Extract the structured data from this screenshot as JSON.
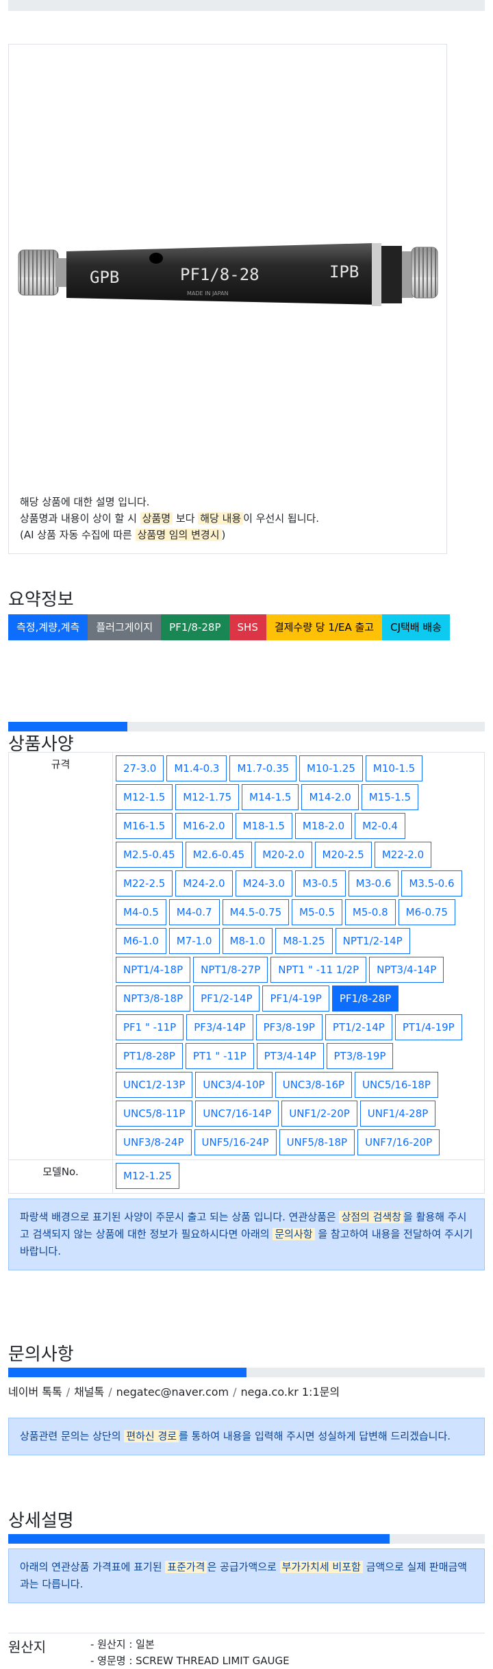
{
  "product": {
    "image_text": {
      "left": "GPB",
      "middle": "PF1/8-28",
      "right": "IPB",
      "small": "MADE IN JAPAN"
    },
    "desc_line1": "해당 상품에 대한 설명 입니다.",
    "desc_line2_a": "상품명과 내용이 상이 할 시 ",
    "desc_line2_hl1": "상품명",
    "desc_line2_b": " 보다 ",
    "desc_line2_hl2": "해당 내용",
    "desc_line2_c": "이 우선시 됩니다.",
    "desc_line3_a": "(AI 상품 자동 수집에 따른 ",
    "desc_line3_hl": "상품명 임의 변경시",
    "desc_line3_b": ")"
  },
  "summary": {
    "title": "요약정보",
    "badges": [
      {
        "label": "측정,계량,계측",
        "bg": "#0d6efd",
        "fg": "#ffffff"
      },
      {
        "label": "플러그게이지",
        "bg": "#6c757d",
        "fg": "#ffffff"
      },
      {
        "label": "PF1/8-28P",
        "bg": "#198754",
        "fg": "#ffffff"
      },
      {
        "label": "SHS",
        "bg": "#dc3545",
        "fg": "#ffffff"
      },
      {
        "label": "결제수량 당 1/EA 출고",
        "bg": "#ffc107",
        "fg": "#000000"
      },
      {
        "label": "CJ택배 배송",
        "bg": "#0dcaf0",
        "fg": "#000000"
      }
    ]
  },
  "spec": {
    "title": "상품사양",
    "progress": 0.25,
    "spec_label": "규격",
    "model_label": "모델No.",
    "rows": [
      [
        "27-3.0",
        "M1.4-0.3",
        "M1.7-0.35",
        "M10-1.25",
        "M10-1.5"
      ],
      [
        "M12-1.5",
        "M12-1.75",
        "M14-1.5",
        "M14-2.0",
        "M15-1.5"
      ],
      [
        "M16-1.5",
        "M16-2.0",
        "M18-1.5",
        "M18-2.0",
        "M2-0.4"
      ],
      [
        "M2.5-0.45",
        "M2.6-0.45",
        "M20-2.0",
        "M20-2.5",
        "M22-2.0"
      ],
      [
        "M22-2.5",
        "M24-2.0",
        "M24-3.0",
        "M3-0.5",
        "M3-0.6",
        "M3.5-0.6"
      ],
      [
        "M4-0.5",
        "M4-0.7",
        "M4.5-0.75",
        "M5-0.5",
        "M5-0.8",
        "M6-0.75"
      ],
      [
        "M6-1.0",
        "M7-1.0",
        "M8-1.0",
        "M8-1.25",
        "NPT1/2-14P"
      ],
      [
        "NPT1/4-18P",
        "NPT1/8-27P",
        "NPT1 \" -11 1/2P",
        "NPT3/4-14P"
      ],
      [
        "NPT3/8-18P",
        "PF1/2-14P",
        "PF1/4-19P",
        "PF1/8-28P"
      ],
      [
        "PF1 \" -11P",
        "PF3/4-14P",
        "PF3/8-19P",
        "PT1/2-14P",
        "PT1/4-19P"
      ],
      [
        "PT1/8-28P",
        "PT1 \" -11P",
        "PT3/4-14P",
        "PT3/8-19P"
      ],
      [
        "UNC1/2-13P",
        "UNC3/4-10P",
        "UNC3/8-16P",
        "UNC5/16-18P"
      ],
      [
        "UNC5/8-11P",
        "UNC7/16-14P",
        "UNF1/2-20P",
        "UNF1/4-28P"
      ],
      [
        "UNF3/8-24P",
        "UNF5/16-24P",
        "UNF5/8-18P",
        "UNF7/16-20P"
      ]
    ],
    "selected": "PF1/8-28P",
    "models": [
      "M12-1.25"
    ],
    "notice_a": "파랑색 배경으로 표기된 사양이 주문시 출고 되는 상품 입니다. 연관상품은 ",
    "notice_hl1": "상점의 검색창",
    "notice_b": "을 활용해 주시고 검색되지 않는 상품에 대한 정보가 필요하시다면 아래의 ",
    "notice_hl2": "문의사항",
    "notice_c": " 을 참고하여 내용을 전달하여 주시기 바랍니다."
  },
  "inquiry": {
    "title": "문의사항",
    "progress": 0.5,
    "contacts": [
      "네이버 톡톡",
      "채널톡",
      "negatec@naver.com",
      "nega.co.kr 1:1문의"
    ],
    "sep": "/",
    "notice_a": "상품관련 문의는 상단의 ",
    "notice_hl": "편하신 경로",
    "notice_b": "를 통하여 내용을 입력해 주시면 성실하게 답변해 드리겠습니다."
  },
  "detail": {
    "title": "상세설명",
    "progress": 0.8,
    "notice_a": "아래의 연관상품 가격표에 표기된 ",
    "notice_hl1": "표준가격",
    "notice_b": "은 공급가액으로 ",
    "notice_hl2": "부가가치세 비포함",
    "notice_c": " 금액으로 실제 판매금액과는 다릅니다."
  },
  "origin": {
    "label": "원산지",
    "line1": "- 원산지 : 일본",
    "line2": "- 영문명 : SCREW THREAD LIMIT GAUGE"
  }
}
